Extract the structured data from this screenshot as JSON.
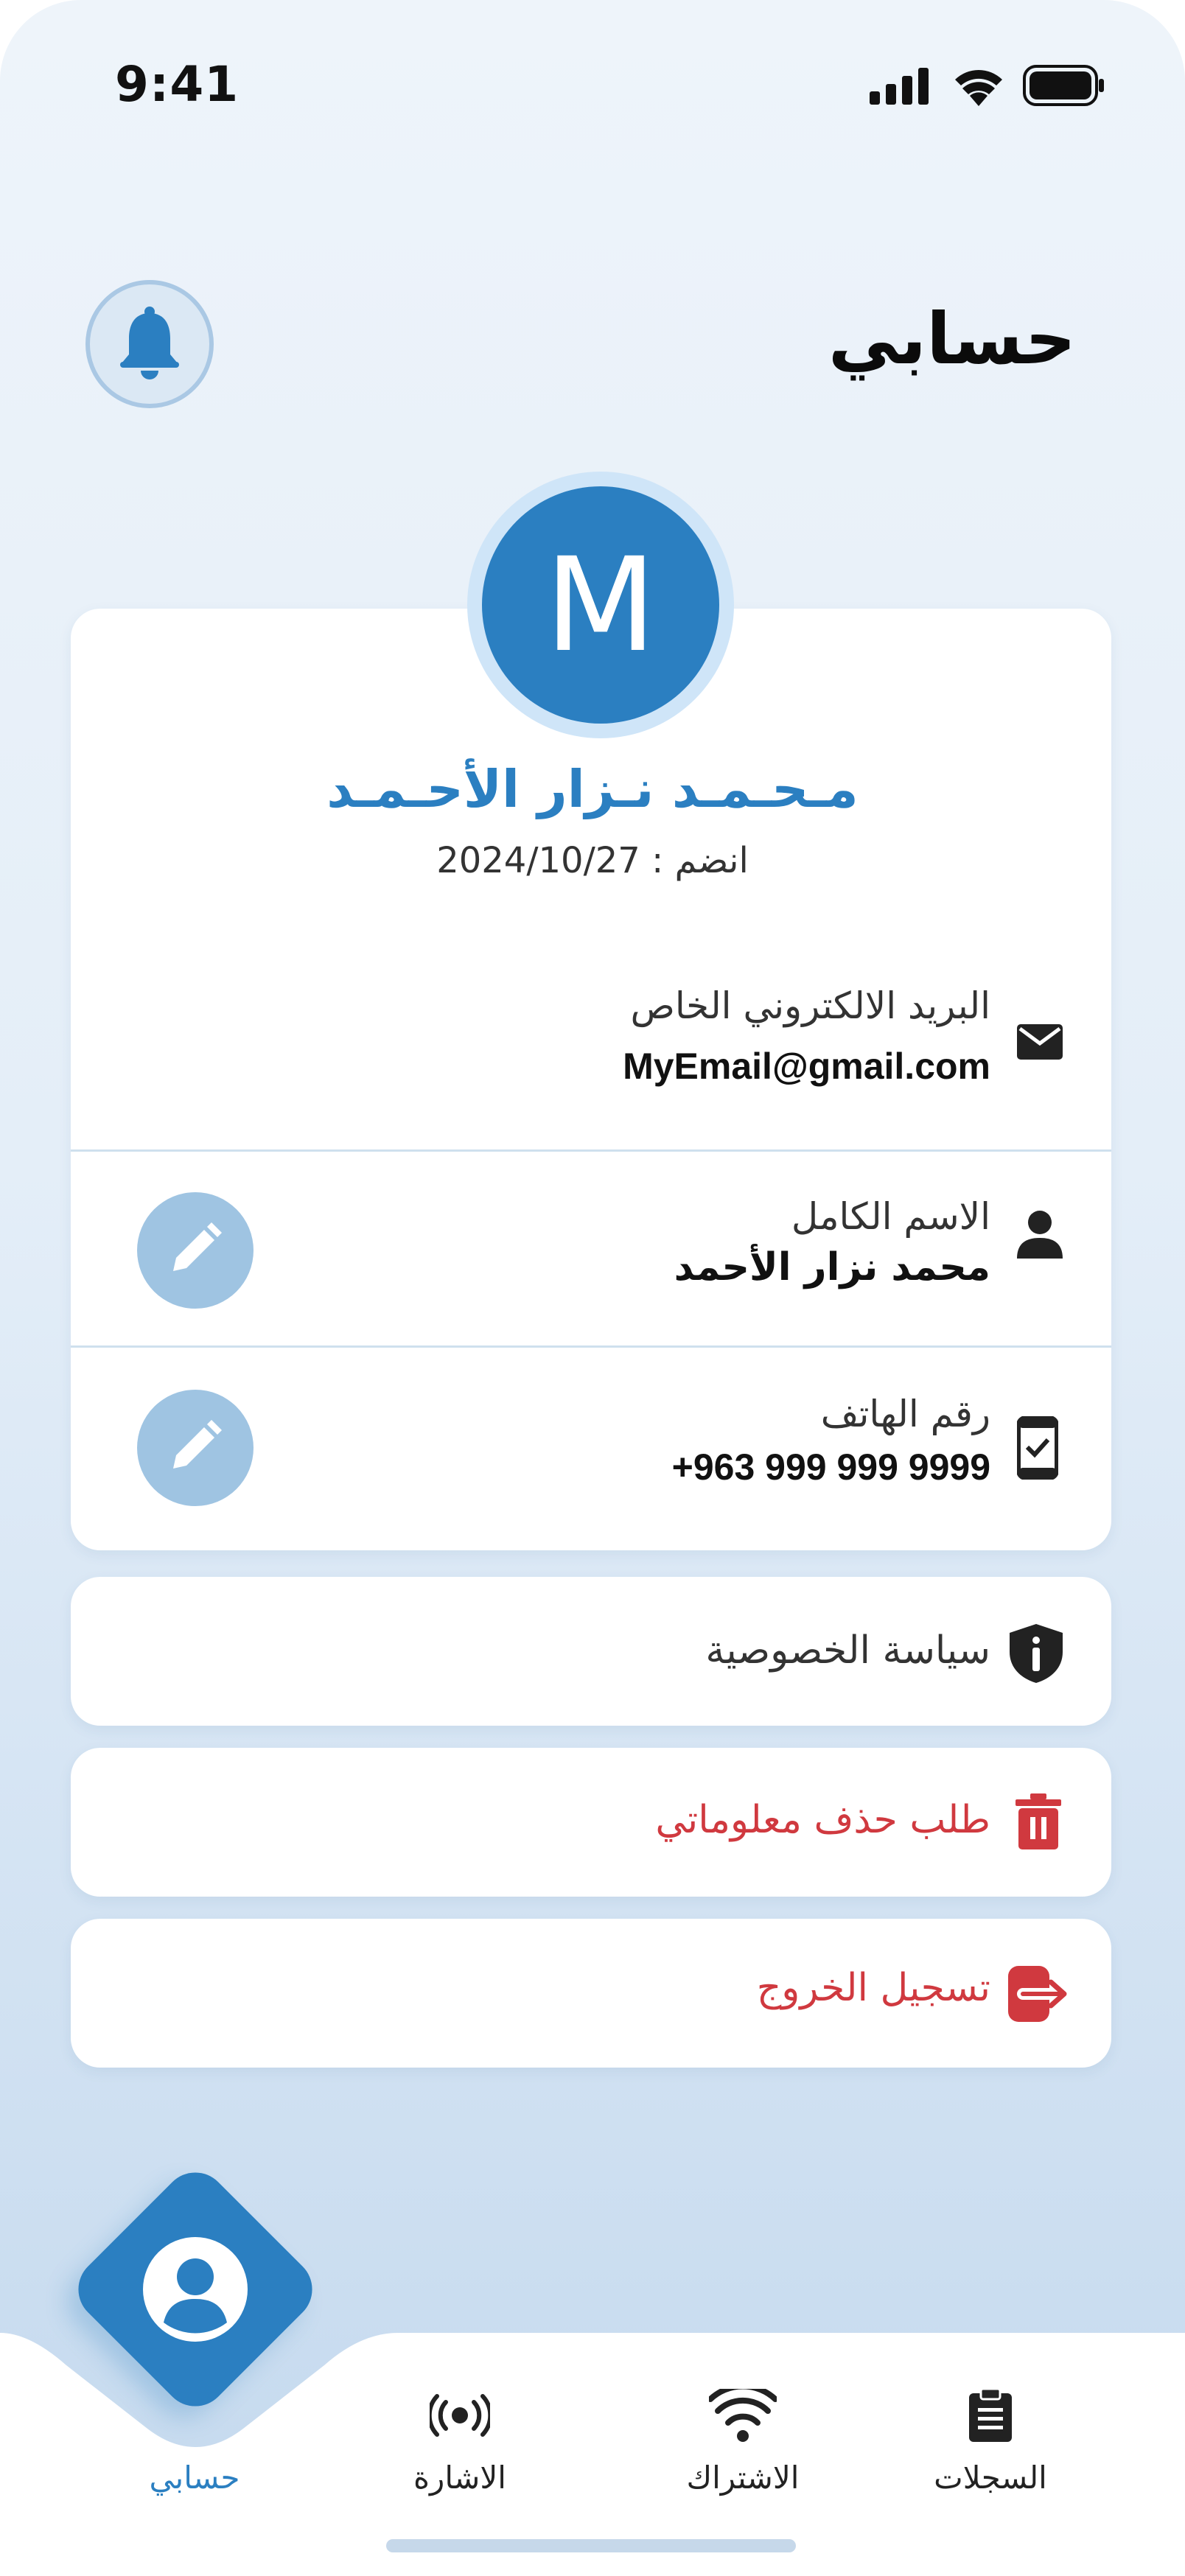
{
  "status_bar": {
    "time": "9:41"
  },
  "header": {
    "title": "حسابي",
    "bell_icon": "bell-icon"
  },
  "profile": {
    "avatar_letter": "M",
    "name": "مـحـمـد نـزار الأحـمـد",
    "joined_text": "انضم : 2024/10/27"
  },
  "fields": [
    {
      "label": "البريد الالكتروني الخاص",
      "value": "MyEmail@gmail.com",
      "icon": "envelope-icon",
      "editable": false
    },
    {
      "label": "الاسم الكامل",
      "value": "محمد نزار الأحمد",
      "icon": "person-icon",
      "editable": true
    },
    {
      "label": "رقم الهاتف",
      "value": "+963 999 999 9999",
      "icon": "phone-check-icon",
      "editable": true
    }
  ],
  "menu": [
    {
      "label": "سياسة الخصوصية",
      "icon": "shield-info-icon",
      "color": "#333333"
    },
    {
      "label": "طلب حذف معلوماتي",
      "icon": "trash-icon",
      "color": "#d0393f"
    },
    {
      "label": "تسجيل الخروج",
      "icon": "logout-icon",
      "color": "#d0393f"
    }
  ],
  "bottom_nav": [
    {
      "label": "السجلات",
      "icon": "clipboard-icon",
      "active": false
    },
    {
      "label": "الاشتراك",
      "icon": "wifi-icon",
      "active": false
    },
    {
      "label": "الاشارة",
      "icon": "signal-icon",
      "active": false
    },
    {
      "label": "حسابي",
      "icon": "account-icon",
      "active": true
    }
  ],
  "colors": {
    "primary": "#2b7fc1",
    "danger": "#d0393f",
    "edit": "#9fc4e2"
  }
}
